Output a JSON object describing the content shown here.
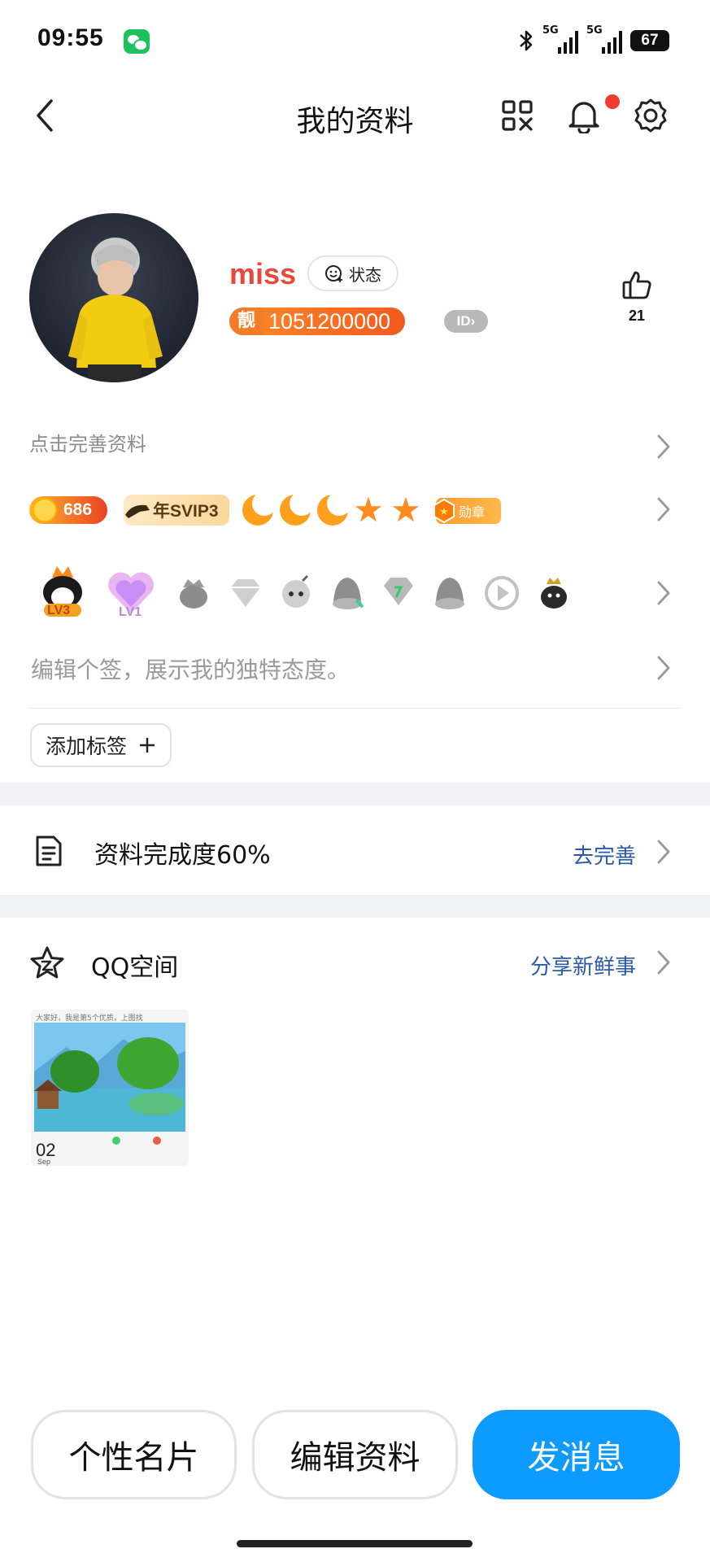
{
  "status_bar": {
    "time": "09:55",
    "network1": "5G",
    "network2": "5G",
    "battery": "67"
  },
  "nav": {
    "title": "我的资料"
  },
  "profile": {
    "nickname": "miss",
    "status_label": "状态",
    "pretty_mark": "靓",
    "qq_number": "1051200000",
    "id_badge": "ID",
    "like_count": "21"
  },
  "complete_prompt": "点击完善资料",
  "vip_row": {
    "coin_value": "686",
    "svip_label": "年SVIP3",
    "medal_label": "勋章"
  },
  "badges": {
    "lv3": "LV3",
    "lv1": "LV1"
  },
  "signature_placeholder": "编辑个签，展示我的独特态度。",
  "add_tag_label": "添加标签",
  "completion": {
    "label": "资料完成度60%",
    "action": "去完善"
  },
  "qzone": {
    "title": "QQ空间",
    "action": "分享新鲜事",
    "thumb_caption": "大家好，我是第5个优质，上图找",
    "thumb_day": "02",
    "thumb_month": "Sep"
  },
  "bottom_buttons": {
    "card": "个性名片",
    "edit": "编辑资料",
    "message": "发消息"
  },
  "colors": {
    "accent_blue": "#0d9bff",
    "nickname_red": "#e8493b",
    "link_blue": "#2a5aa8",
    "notif_dot": "#f23b30"
  }
}
